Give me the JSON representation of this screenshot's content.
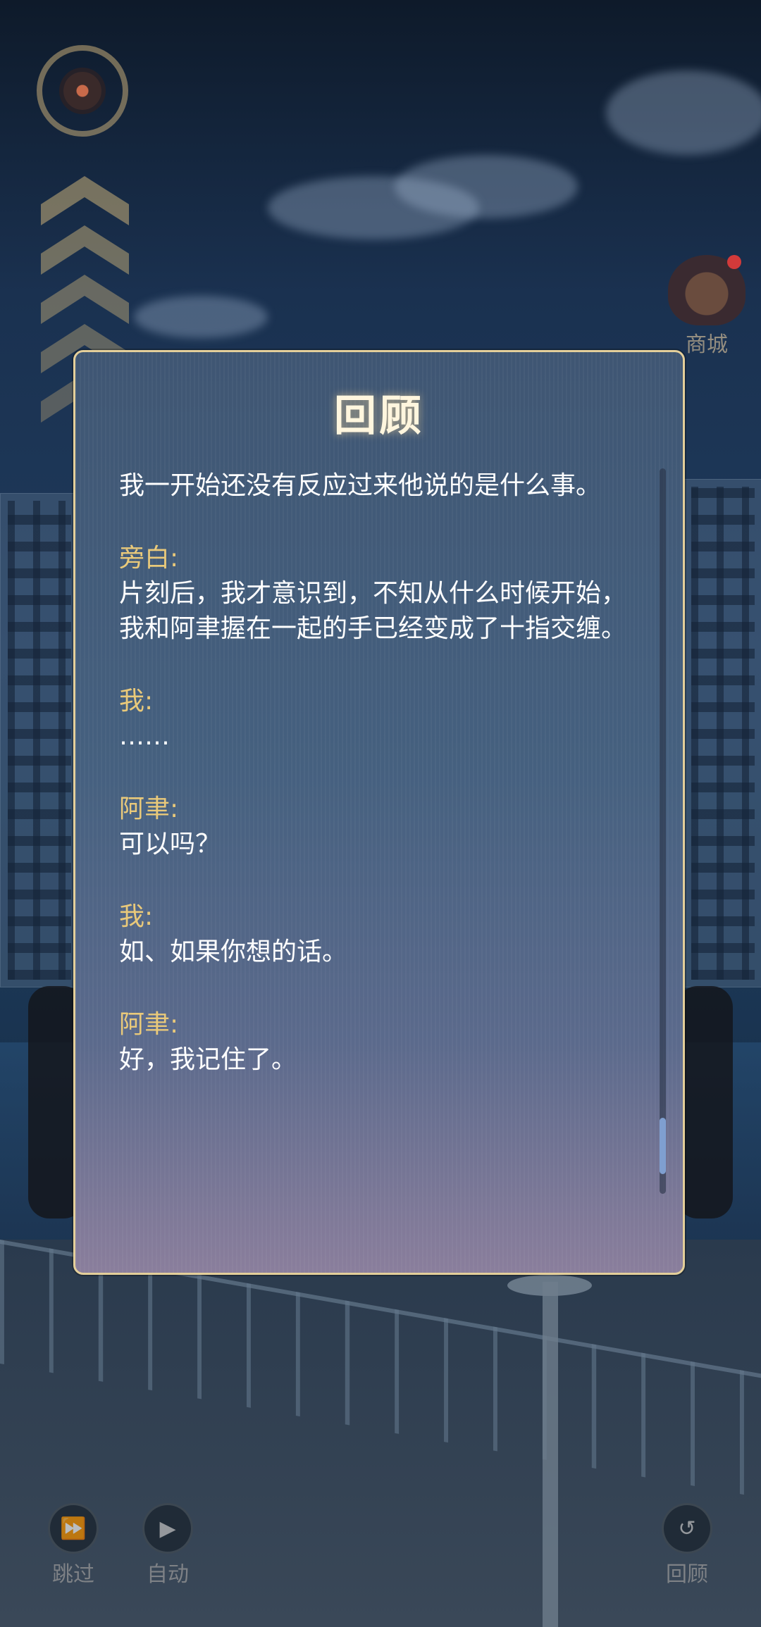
{
  "panel": {
    "title": "回顾",
    "entries": [
      {
        "speaker": "",
        "text": "我一开始还没有反应过来他说的是什么事。"
      },
      {
        "speaker": "旁白:",
        "text": "片刻后，我才意识到，不知从什么时候开始，我和阿聿握在一起的手已经变成了十指交缠。"
      },
      {
        "speaker": "我:",
        "text": "……"
      },
      {
        "speaker": "阿聿:",
        "text": "可以吗？"
      },
      {
        "speaker": "我:",
        "text": "如、如果你想的话。"
      },
      {
        "speaker": "阿聿:",
        "text": "好，我记住了。"
      }
    ],
    "scroll_position": 0.95
  },
  "shop": {
    "label": "商城",
    "icon": "shop-avatar-icon"
  },
  "controls": {
    "skip": {
      "label": "跳过",
      "icon": "fast-forward-icon"
    },
    "auto": {
      "label": "自动",
      "icon": "play-icon"
    },
    "review": {
      "label": "回顾",
      "icon": "rewind-icon"
    }
  },
  "colors": {
    "panel_border": "#e4cf9a",
    "speaker": "#e9c97a",
    "text": "#ffffff",
    "title_glow": "#fff6de"
  }
}
